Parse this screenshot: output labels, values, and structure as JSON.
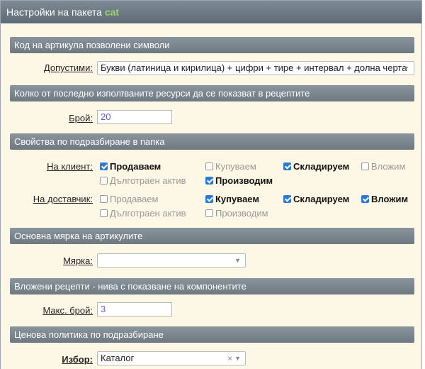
{
  "header": {
    "title": "Настройки на пакета",
    "package": "cat"
  },
  "sections": {
    "article_code": {
      "title": "Код на артикула позволени символи",
      "label": "Допустими:",
      "value": "Букви (латиница и кирилица) + цифри + тире + интервал + долна черта"
    },
    "recent_resources": {
      "title": "Колко от последно изполזваните ресурси да се показват в рецептите",
      "label": "Брой:",
      "value": "20"
    },
    "folder_defaults": {
      "title": "Свойства по подразбиране в папка",
      "client_label": "На клиент:",
      "supplier_label": "На доставчик:",
      "client": [
        {
          "label": "Продаваем",
          "checked": true
        },
        {
          "label": "Купуваем",
          "checked": false
        },
        {
          "label": "Складируем",
          "checked": true
        },
        {
          "label": "Вложим",
          "checked": false
        },
        {
          "label": "Дълготраен актив",
          "checked": false
        },
        {
          "label": "Производим",
          "checked": true
        }
      ],
      "supplier": [
        {
          "label": "Продаваем",
          "checked": false
        },
        {
          "label": "Купуваем",
          "checked": true
        },
        {
          "label": "Складируем",
          "checked": true
        },
        {
          "label": "Вложим",
          "checked": true
        },
        {
          "label": "Дълготраен актив",
          "checked": false
        },
        {
          "label": "Производим",
          "checked": false
        }
      ]
    },
    "base_measure": {
      "title": "Основна мярка на артикулите",
      "label": "Мярка:",
      "value": ""
    },
    "nested_recipes": {
      "title": "Вложени рецепти - нива с показване на компонентите",
      "label": "Макс. брой:",
      "value": "3"
    },
    "pricing": {
      "title": "Ценова политика по подразбиране",
      "label": "Избор:",
      "value": "Каталог"
    }
  }
}
